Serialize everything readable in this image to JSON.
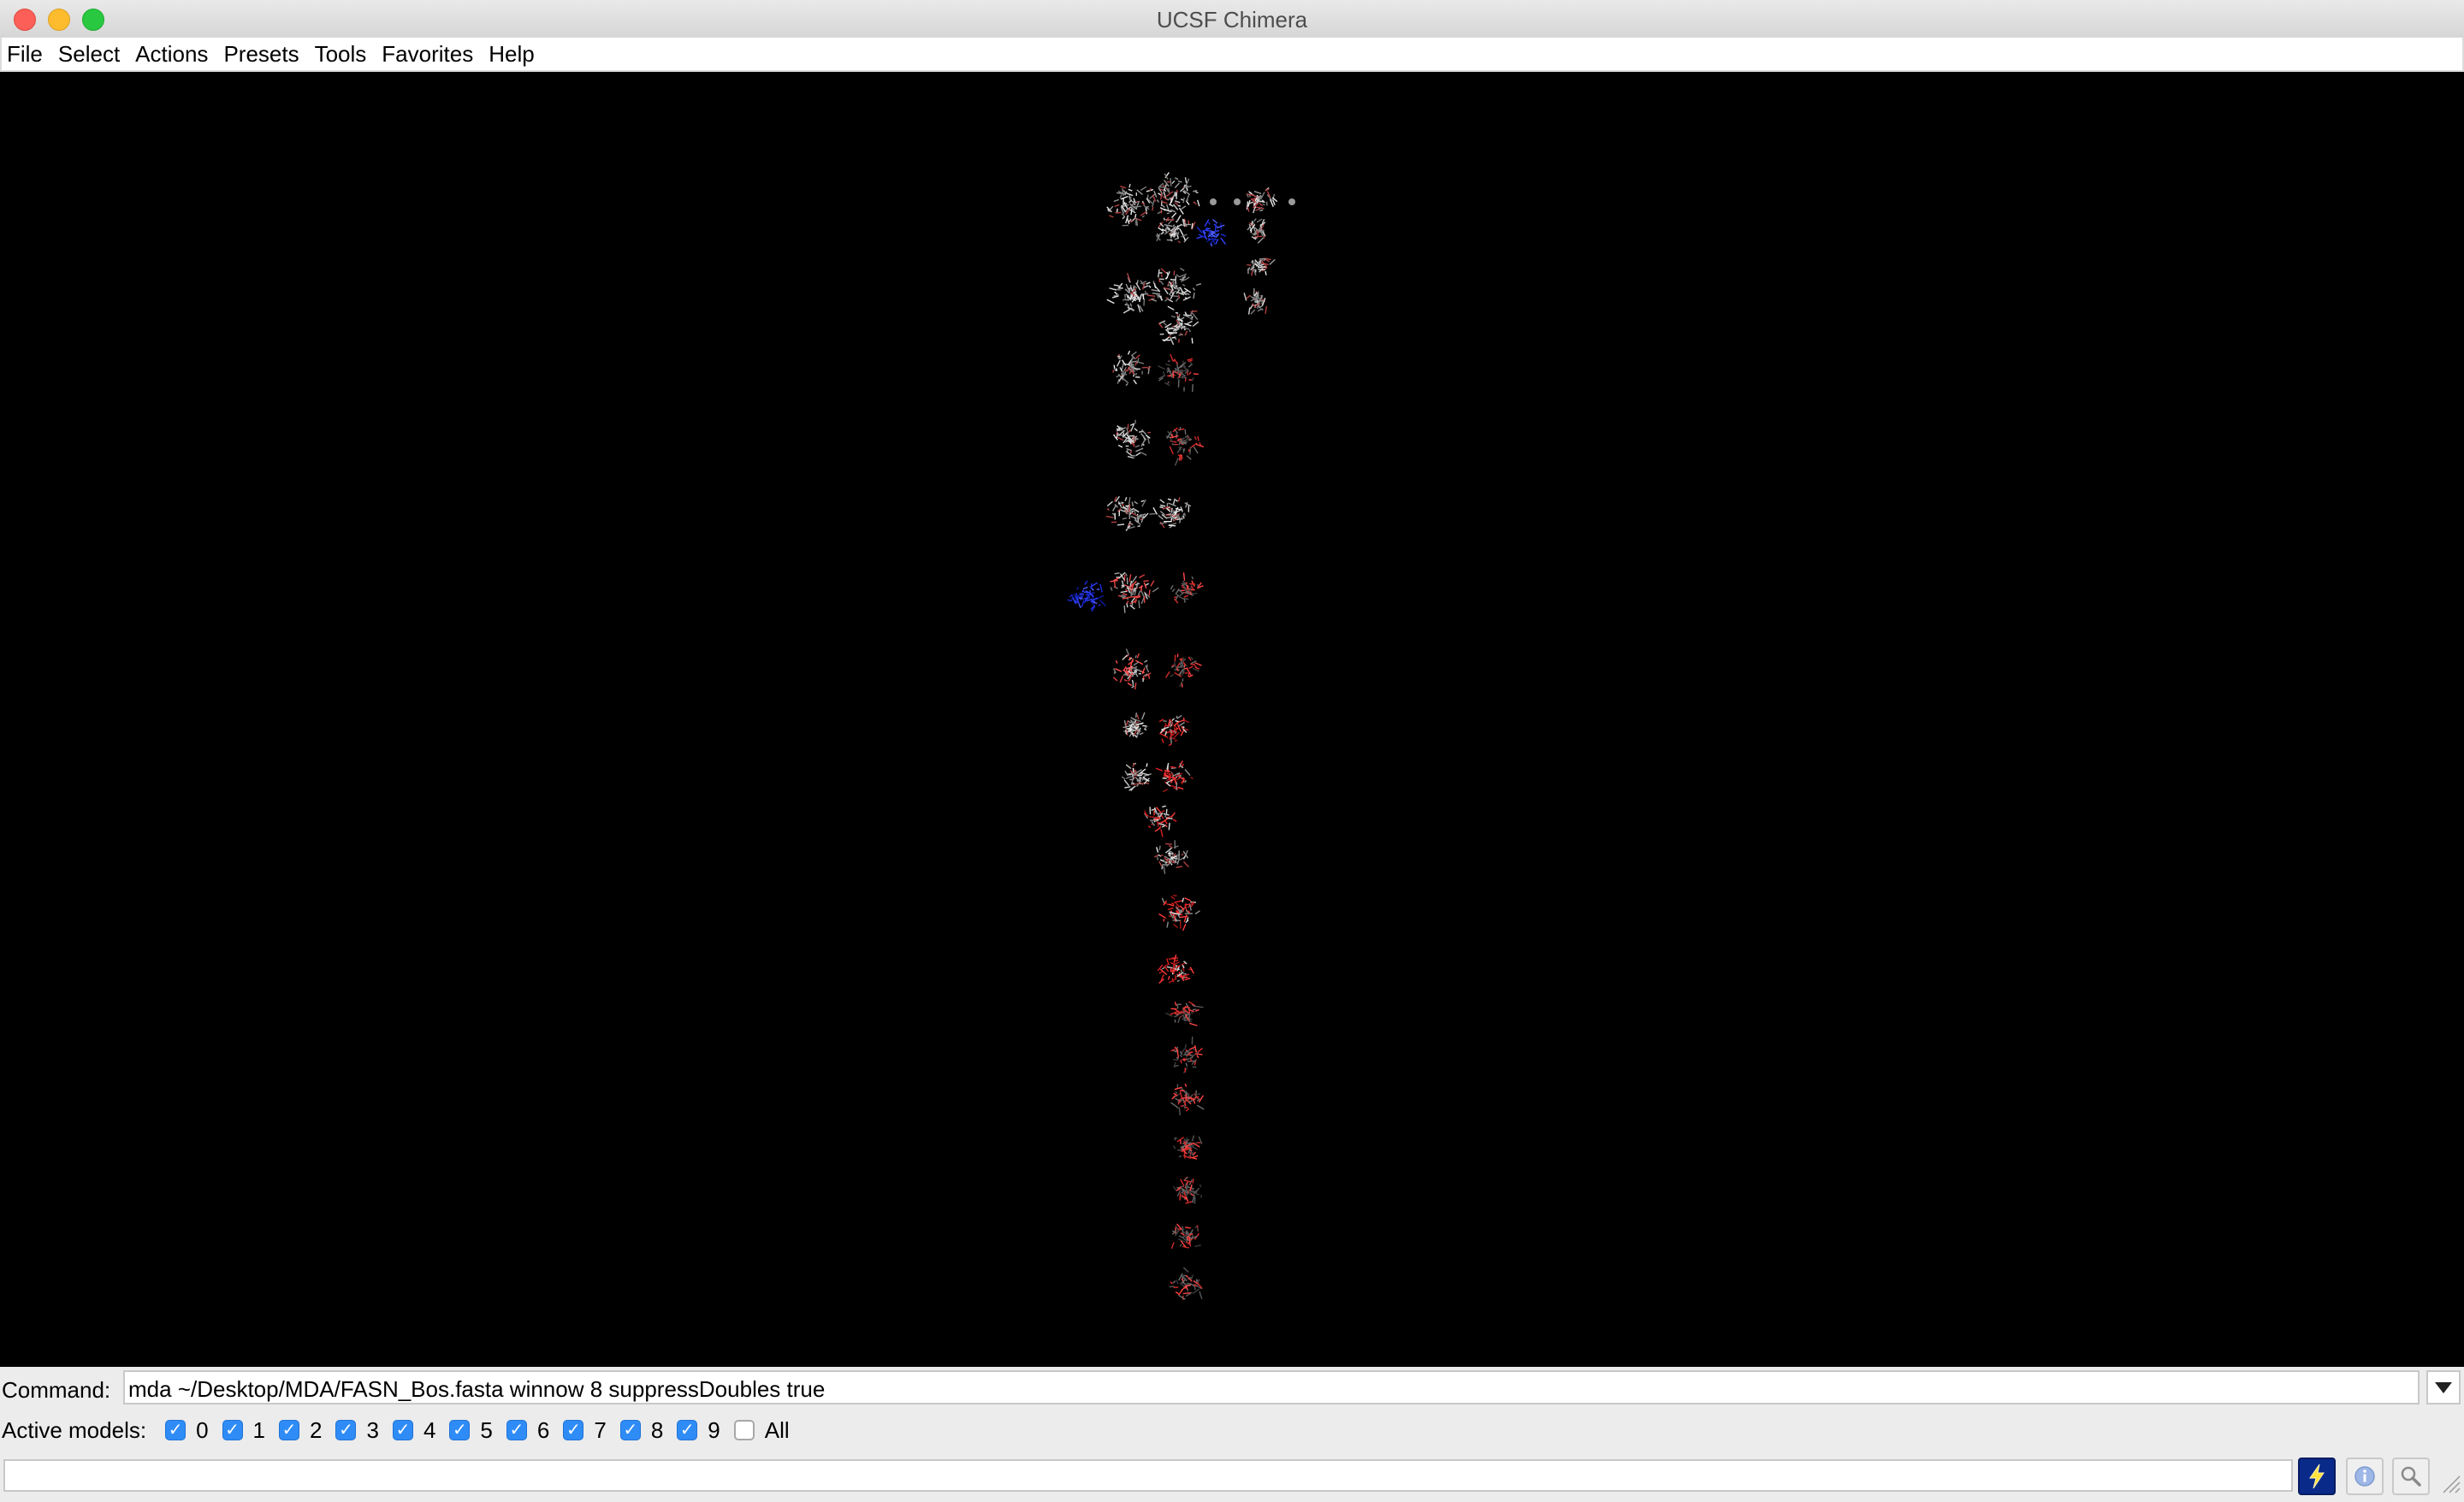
{
  "window": {
    "title": "UCSF Chimera"
  },
  "menubar": {
    "items": [
      {
        "label": "File"
      },
      {
        "label": "Select"
      },
      {
        "label": "Actions"
      },
      {
        "label": "Presets"
      },
      {
        "label": "Tools"
      },
      {
        "label": "Favorites"
      },
      {
        "label": "Help"
      }
    ]
  },
  "command": {
    "label": "Command:",
    "value": "mda ~/Desktop/MDA/FASN_Bos.fasta winnow 8 suppressDoubles true"
  },
  "active_models": {
    "label": "Active models:",
    "models": [
      {
        "label": "0",
        "checked": true
      },
      {
        "label": "1",
        "checked": true
      },
      {
        "label": "2",
        "checked": true
      },
      {
        "label": "3",
        "checked": true
      },
      {
        "label": "4",
        "checked": true
      },
      {
        "label": "5",
        "checked": true
      },
      {
        "label": "6",
        "checked": true
      },
      {
        "label": "7",
        "checked": true
      },
      {
        "label": "8",
        "checked": true
      },
      {
        "label": "9",
        "checked": true
      }
    ],
    "all": {
      "label": "All",
      "checked": false
    }
  },
  "status": {
    "text": ""
  },
  "icons": {
    "status_buttons": [
      "lightning-icon",
      "info-icon",
      "magnifier-icon"
    ]
  },
  "colors": {
    "viewport_background": "#000000",
    "checkbox_accent": "#2f8cf6"
  }
}
